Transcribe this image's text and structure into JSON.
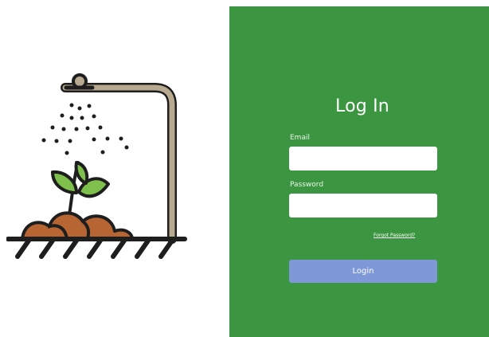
{
  "login": {
    "title": "Log In",
    "email_label": "Email",
    "email_value": "",
    "password_label": "Password",
    "password_value": "",
    "forgot_link": "Forgot Password?",
    "login_button": "Login"
  },
  "illustration": {
    "icon_name": "watering-plant-icon"
  },
  "colors": {
    "panel_green": "#3c9541",
    "button_blue": "#7f98d8"
  }
}
